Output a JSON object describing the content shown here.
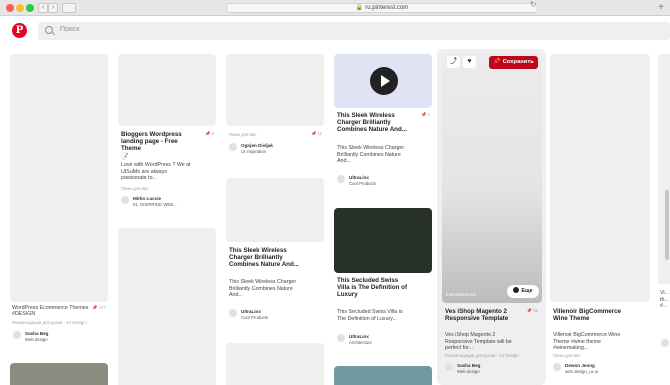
{
  "browser": {
    "url": "ru.pinterest.com",
    "back": "‹",
    "forward": "›",
    "reload": "↻",
    "new_tab": "+"
  },
  "header": {
    "logo": "P",
    "search_placeholder": "Поиск"
  },
  "pins": {
    "c1a": {
      "meta": "Рекомендации для доски - AJ Design -",
      "count": "177",
      "title": "WordPress Ecommerce Themes #DESIGN",
      "user": "Sasha Beg",
      "board": "Web design"
    },
    "c2a": {
      "title": "Bloggers Wordpress landing page - Free Theme",
      "count": "6",
      "emoji": "📝",
      "desc": "Love with WordPress ? We at UISuMo are always passionate to...",
      "meta": "Пины для вас",
      "user": "Mirko Luccie",
      "board": "01. INSPIRING WEB..."
    },
    "c3a": {
      "meta": "Пины для вас",
      "count": "11",
      "user": "Ognjen Divljak",
      "board": "UI inspiration"
    },
    "c3b": {
      "title": "This Sleek Wireless Charger Brilliantly Combines Nature And...",
      "desc": "This Sleek Wireless Charger Brilliantly Combines Nature And...",
      "user": "UltraLinx",
      "board": "Cool Products"
    },
    "c4a": {
      "title": "This Sleek Wireless Charger Brilliantly Combines Nature And...",
      "count": "1",
      "desc": "This Sleek Wireless Charger Brilliantly Combines Nature And...",
      "user": "UltraLinx",
      "board": "Cool Products"
    },
    "c4b": {
      "title": "This Secluded Swiss Villa is The Definition of Luxury",
      "desc": "This Secluded Swiss Villa is The Definition of Luxury...",
      "user": "UltraLinx",
      "board": "Architecture"
    },
    "c5a": {
      "save": "Сохранить",
      "more": "Еще",
      "source": "themeforest.net",
      "title": "Ves iShop Magento 2 Responsive Template",
      "count": "38",
      "desc": "Ves iShop Magento 2 Responsive Template will be perfect for...",
      "meta": "Рекомендации для доски - AJ Design -",
      "user": "Sasha Beg",
      "board": "Web design"
    },
    "c6a": {
      "title": "Villenoir BigCommerce Wine Theme",
      "desc": "Villenoir BigCommerce Wine Theme #wine theme #winemaking...",
      "meta": "Пины для вас",
      "user": "Dewon Jeong",
      "board": "web design_ux ui"
    },
    "c7a": {
      "desc": "Vi... th... #..."
    }
  },
  "icons": {
    "share": "⤴",
    "heart": "♥",
    "pin": "📌",
    "pin_count": "📌"
  },
  "colors": {
    "brand": "#e60023",
    "save_button": "#bd081c",
    "placeholder": "#efefef"
  }
}
